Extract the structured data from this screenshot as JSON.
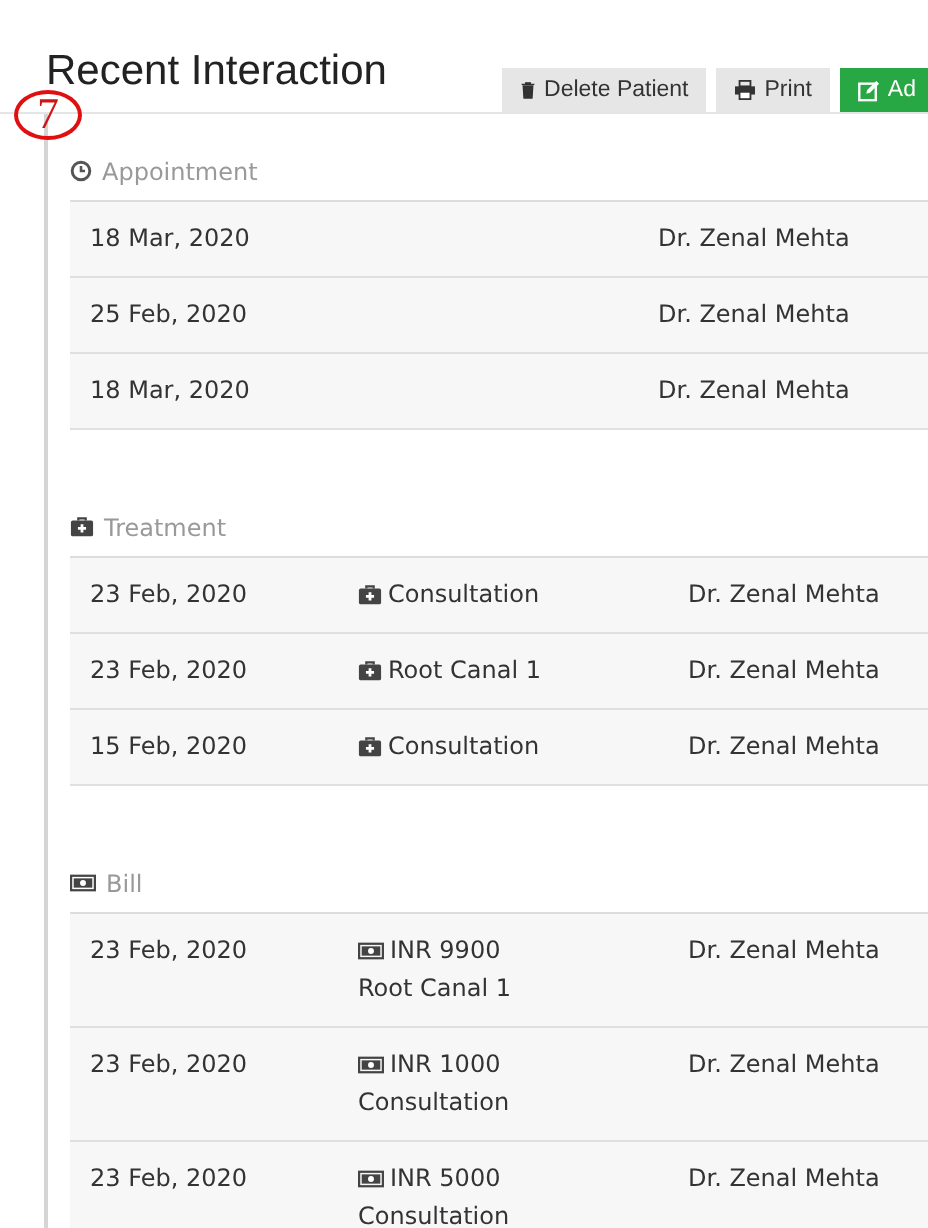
{
  "header": {
    "title": "Recent Interaction",
    "annotation": "7",
    "buttons": [
      {
        "kind": "delete",
        "label": "Delete Patient"
      },
      {
        "kind": "print",
        "label": "Print"
      },
      {
        "kind": "add",
        "label": "Ad"
      }
    ]
  },
  "sections": [
    {
      "kind": "appointment",
      "title": "Appointment",
      "rows": [
        {
          "date": "18 Mar, 2020",
          "doctor": "Dr. Zenal Mehta"
        },
        {
          "date": "25 Feb, 2020",
          "doctor": "Dr. Zenal Mehta"
        },
        {
          "date": "18 Mar, 2020",
          "doctor": "Dr. Zenal Mehta"
        }
      ]
    },
    {
      "kind": "treatment",
      "title": "Treatment",
      "rows": [
        {
          "date": "23 Feb, 2020",
          "item": "Consultation",
          "doctor": "Dr. Zenal Mehta"
        },
        {
          "date": "23 Feb, 2020",
          "item": "Root Canal 1",
          "doctor": "Dr. Zenal Mehta"
        },
        {
          "date": "15 Feb, 2020",
          "item": "Consultation",
          "doctor": "Dr. Zenal Mehta"
        }
      ]
    },
    {
      "kind": "bill",
      "title": "Bill",
      "rows": [
        {
          "date": "23 Feb, 2020",
          "item": "INR 9900",
          "note": "Root Canal 1",
          "doctor": "Dr. Zenal Mehta"
        },
        {
          "date": "23 Feb, 2020",
          "item": "INR 1000",
          "note": "Consultation",
          "doctor": "Dr. Zenal Mehta"
        },
        {
          "date": "23 Feb, 2020",
          "item": "INR 5000",
          "note": "Consultation",
          "doctor": "Dr. Zenal Mehta"
        }
      ]
    }
  ]
}
